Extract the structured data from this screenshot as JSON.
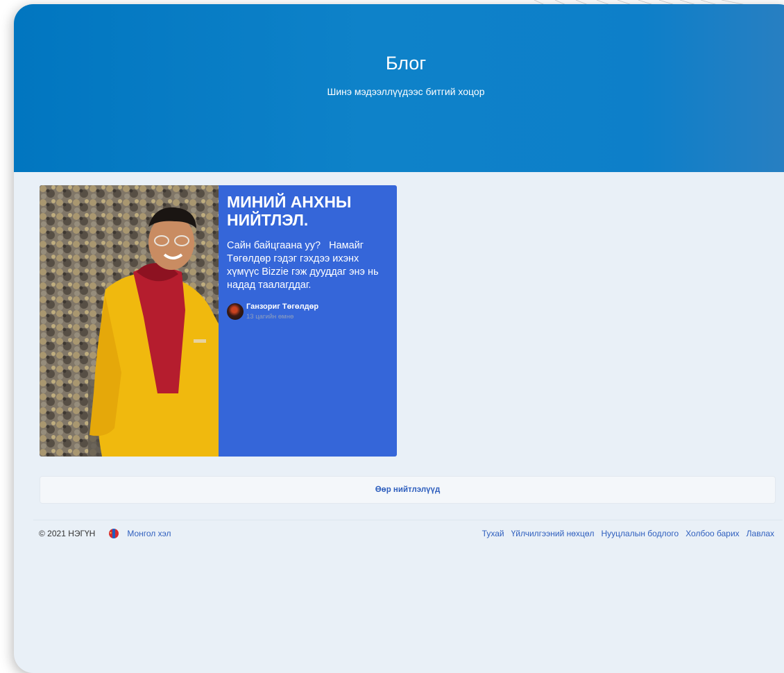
{
  "hero": {
    "title": "Блог",
    "subtitle": "Шинэ мэдээллүүдээс битгий хоцор"
  },
  "post": {
    "image_icon": "photo-person-yellow-hoodie",
    "title": "МИНИЙ АНХНЫ НИЙТЛЭЛ.",
    "excerpt": "Сайн байцгаана уу?   Намайг Төгөлдөр гэдэг гэхдээ ихэнх хүмүүс Bizzie гэж дууддаг энэ нь надад таалагддаг.",
    "author_name": "Ганзориг Төгөлдөр",
    "time_ago": "13 цагийн өмнө"
  },
  "more_button": "Өөр нийтлэлүүд",
  "footer": {
    "copyright": "© 2021 НЭГҮН",
    "language": "Монгол хэл",
    "links": [
      "Тухай",
      "Үйлчилгээний нөхцөл",
      "Нууцлалын бодлого",
      "Холбоо барих",
      "Лавлах"
    ]
  },
  "colors": {
    "hero": "#0176c0",
    "card": "#3566d9",
    "link": "#2f5fbe",
    "page": "#e9f0f7"
  }
}
